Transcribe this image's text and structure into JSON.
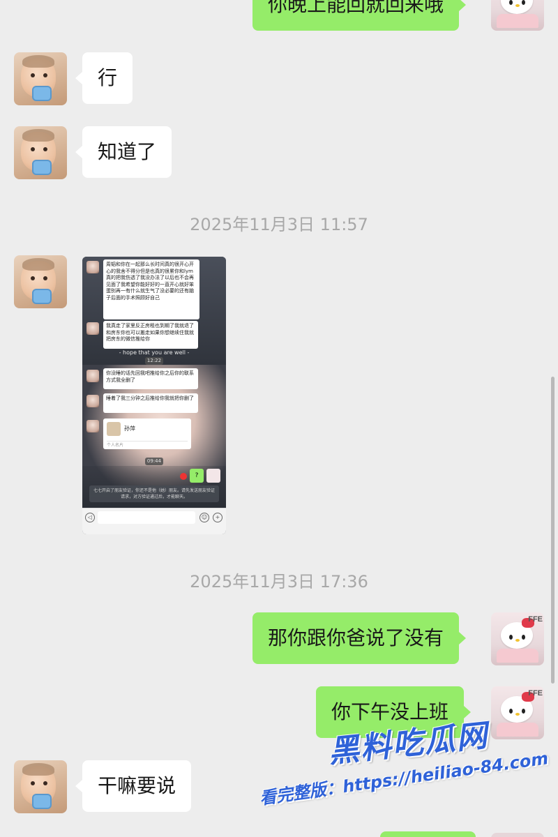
{
  "messages": [
    {
      "id": "m1",
      "side": "out",
      "text": "你晚上能回就回来哦",
      "avatar": "hello-kitty"
    },
    {
      "id": "m2",
      "side": "in",
      "text": "行",
      "avatar": "baby"
    },
    {
      "id": "m3",
      "side": "in",
      "text": "知道了",
      "avatar": "baby"
    },
    {
      "id": "t1",
      "type": "timestamp",
      "text": "2025年11月3日 11:57"
    },
    {
      "id": "m4",
      "side": "in",
      "type": "image",
      "avatar": "baby"
    },
    {
      "id": "t2",
      "type": "timestamp",
      "text": "2025年11月3日 17:36"
    },
    {
      "id": "m5",
      "side": "out",
      "text": "那你跟你爸说了没有",
      "avatar": "hello-kitty"
    },
    {
      "id": "m6",
      "side": "out",
      "text": "你下午没上班",
      "avatar": "hello-kitty"
    },
    {
      "id": "m7",
      "side": "in",
      "text": "干嘛要说",
      "avatar": "baby"
    }
  ],
  "screenshot": {
    "bubble1": "周韬和你在一起那么长时间真的很开心开心的我舍不得分但是也真的很累你和lym真的把我伤透了我没办法了以后也不会再见面了我希望你能好好的一直开心就好笨蛋别再一有什么就生气了没必要的还有脑子后面的手术照顾好自己",
    "bubble2": "我真走了家里反正房租也到期了我就退了和房东你也可以搬走如果你想继续住我就把房东的微信推给你",
    "caption": "- hope that you are well -",
    "time1": "12:22",
    "bubble3": "你没睡的话先回我吧推给你之后你的联系方式我全删了",
    "bubble4": "睡着了我三分钟之后推给你我就把你删了",
    "card_name": "孙萍",
    "card_label": "个人名片",
    "time2": "09:44",
    "reply": "?",
    "system_notice": "七七开启了朋友验证，你还不是他（她）朋友。请先发送朋友验证请求，对方验证通过后，才能聊天。"
  },
  "avatar_label": "FFE",
  "watermark": {
    "brand": "黑料吃瓜网",
    "url_line": "看完整版：https://heiliao-84.com"
  },
  "colors": {
    "background": "#ededed",
    "outgoing_bubble": "#95ec69",
    "incoming_bubble": "#ffffff",
    "timestamp": "#a8a8a8",
    "watermark": "#2f62d8"
  }
}
